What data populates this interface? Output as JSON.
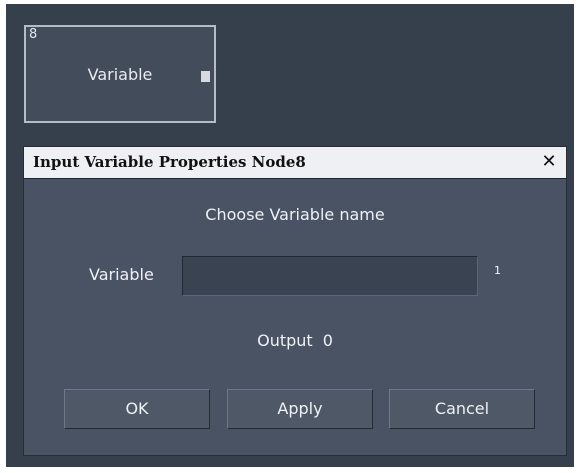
{
  "node": {
    "number": "8",
    "label": "Variable"
  },
  "dialog": {
    "title": "Input Variable Properties Node8",
    "close_label": "✕",
    "heading": "Choose Variable name",
    "variable_label": "Variable",
    "variable_value": "",
    "variable_count": "1",
    "output_label": "Output",
    "output_value": "0",
    "buttons": {
      "ok": "OK",
      "apply": "Apply",
      "cancel": "Cancel"
    }
  },
  "colors": {
    "canvas_bg": "#36404d",
    "dialog_bg": "#495363",
    "titlebar_bg": "#eef0f3",
    "text": "#eef1f5"
  }
}
